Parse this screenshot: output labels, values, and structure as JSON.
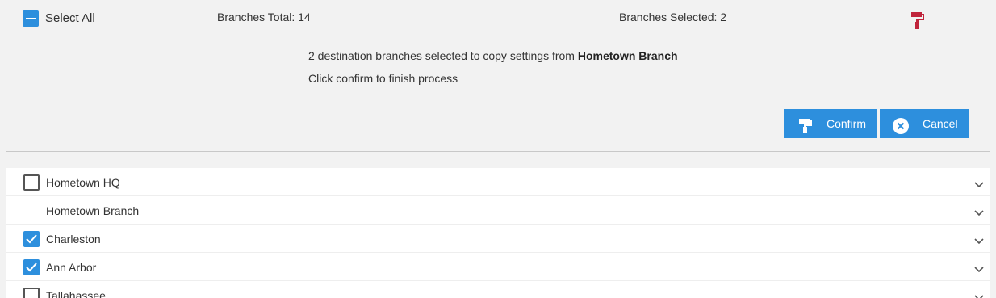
{
  "header": {
    "select_all_label": "Select All",
    "branches_total": "Branches Total: 14",
    "branches_selected": "Branches Selected: 2",
    "paint_icon": "paint-roller-icon",
    "paint_icon_color": "#c0243b"
  },
  "message": {
    "line1_prefix": "2 destination branches selected to copy settings from ",
    "line1_branch": "Hometown Branch",
    "line2": "Click confirm to finish process"
  },
  "actions": {
    "confirm_label": "Confirm",
    "cancel_label": "Cancel",
    "button_color": "#2d8fdd"
  },
  "branches": [
    {
      "label": "Hometown HQ",
      "checkbox": "unchecked"
    },
    {
      "label": "Hometown Branch",
      "checkbox": "none"
    },
    {
      "label": "Charleston",
      "checkbox": "checked"
    },
    {
      "label": "Ann Arbor",
      "checkbox": "checked"
    },
    {
      "label": "Tallahassee",
      "checkbox": "unchecked"
    }
  ],
  "accent_color": "#2d8fdd"
}
